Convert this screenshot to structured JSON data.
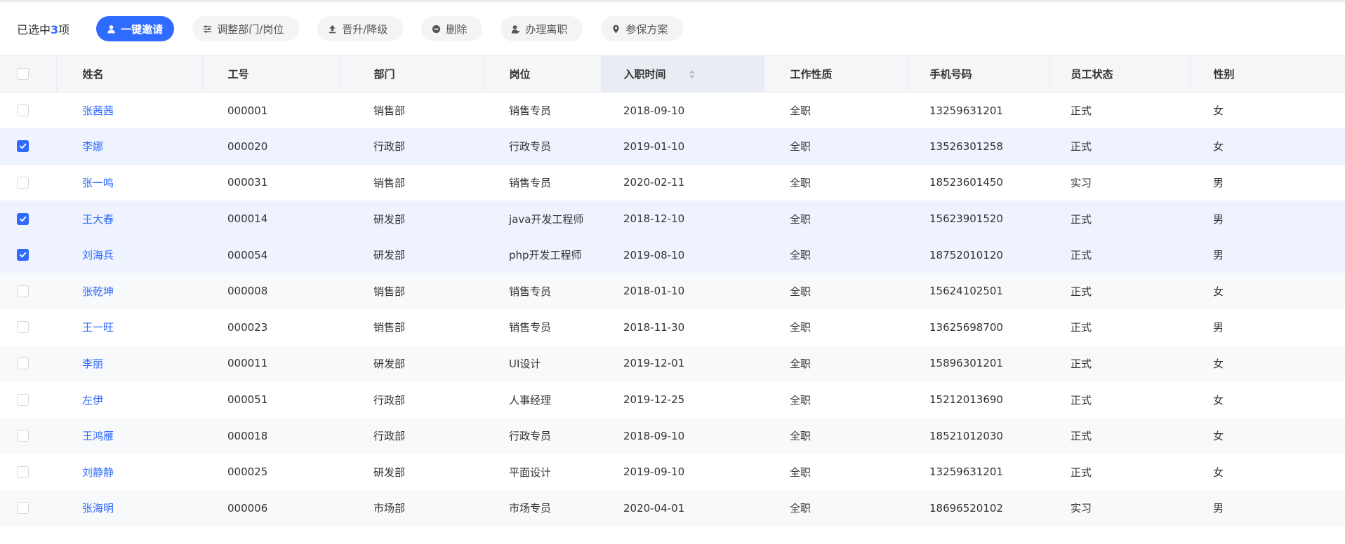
{
  "toolbar": {
    "selected_prefix": "已选中",
    "selected_count": "3",
    "selected_suffix": "项",
    "buttons": [
      {
        "label": "一键邀请",
        "icon": "user-icon",
        "primary": true
      },
      {
        "label": "调整部门/岗位",
        "icon": "sliders-icon",
        "primary": false
      },
      {
        "label": "晋升/降级",
        "icon": "upload-icon",
        "primary": false
      },
      {
        "label": "删除",
        "icon": "minus-circle-icon",
        "primary": false
      },
      {
        "label": "办理离职",
        "icon": "user-leave-icon",
        "primary": false
      },
      {
        "label": "参保方案",
        "icon": "location-pin-icon",
        "primary": false
      }
    ]
  },
  "colors": {
    "accent": "#2f6bff",
    "header_bg": "#f5f6f8",
    "selected_row_bg": "#eef3fe"
  },
  "table": {
    "columns": [
      "姓名",
      "工号",
      "部门",
      "岗位",
      "入职时间",
      "工作性质",
      "手机号码",
      "员工状态",
      "性别"
    ],
    "sorted_column": "入职时间",
    "rows": [
      {
        "checked": false,
        "name": "张茜茜",
        "id": "000001",
        "dept": "销售部",
        "position": "销售专员",
        "date": "2018-09-10",
        "type": "全职",
        "phone": "13259631201",
        "status": "正式",
        "gender": "女"
      },
      {
        "checked": true,
        "name": "李娜",
        "id": "000020",
        "dept": "行政部",
        "position": "行政专员",
        "date": "2019-01-10",
        "type": "全职",
        "phone": "13526301258",
        "status": "正式",
        "gender": "女"
      },
      {
        "checked": false,
        "name": "张一鸣",
        "id": "000031",
        "dept": "销售部",
        "position": "销售专员",
        "date": "2020-02-11",
        "type": "全职",
        "phone": "18523601450",
        "status": "实习",
        "gender": "男"
      },
      {
        "checked": true,
        "name": "王大春",
        "id": "000014",
        "dept": "研发部",
        "position": "java开发工程师",
        "date": "2018-12-10",
        "type": "全职",
        "phone": "15623901520",
        "status": "正式",
        "gender": "男"
      },
      {
        "checked": true,
        "name": "刘海兵",
        "id": "000054",
        "dept": "研发部",
        "position": "php开发工程师",
        "date": "2019-08-10",
        "type": "全职",
        "phone": "18752010120",
        "status": "正式",
        "gender": "男"
      },
      {
        "checked": false,
        "name": "张乾坤",
        "id": "000008",
        "dept": "销售部",
        "position": "销售专员",
        "date": "2018-01-10",
        "type": "全职",
        "phone": "15624102501",
        "status": "正式",
        "gender": "女"
      },
      {
        "checked": false,
        "name": "王一旺",
        "id": "000023",
        "dept": "销售部",
        "position": "销售专员",
        "date": "2018-11-30",
        "type": "全职",
        "phone": "13625698700",
        "status": "正式",
        "gender": "男"
      },
      {
        "checked": false,
        "name": "李丽",
        "id": "000011",
        "dept": "研发部",
        "position": "UI设计",
        "date": "2019-12-01",
        "type": "全职",
        "phone": "15896301201",
        "status": "正式",
        "gender": "女"
      },
      {
        "checked": false,
        "name": "左伊",
        "id": "000051",
        "dept": "行政部",
        "position": "人事经理",
        "date": "2019-12-25",
        "type": "全职",
        "phone": "15212013690",
        "status": "正式",
        "gender": "女"
      },
      {
        "checked": false,
        "name": "王鸿雁",
        "id": "000018",
        "dept": "行政部",
        "position": "行政专员",
        "date": "2018-09-10",
        "type": "全职",
        "phone": "18521012030",
        "status": "正式",
        "gender": "女"
      },
      {
        "checked": false,
        "name": "刘静静",
        "id": "000025",
        "dept": "研发部",
        "position": "平面设计",
        "date": "2019-09-10",
        "type": "全职",
        "phone": "13259631201",
        "status": "正式",
        "gender": "女"
      },
      {
        "checked": false,
        "name": "张海明",
        "id": "000006",
        "dept": "市场部",
        "position": "市场专员",
        "date": "2020-04-01",
        "type": "全职",
        "phone": "18696520102",
        "status": "实习",
        "gender": "男"
      }
    ]
  }
}
